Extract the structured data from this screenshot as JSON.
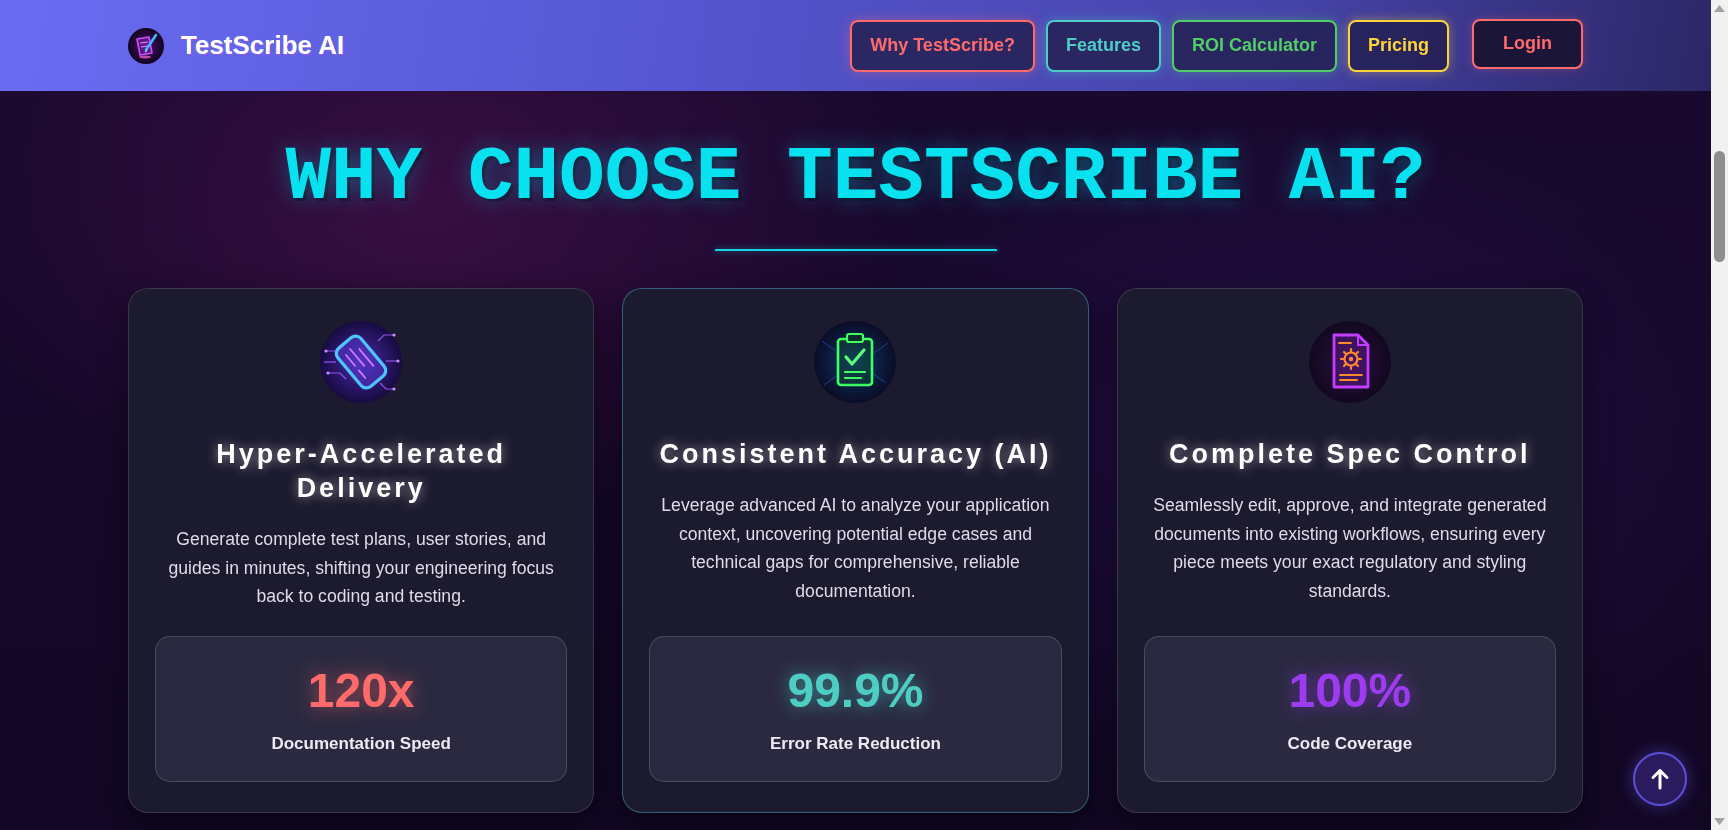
{
  "navbar": {
    "brand": "TestScribe AI",
    "links": [
      {
        "label": "Why TestScribe?",
        "kind": "link",
        "color": "#ff6b6b"
      },
      {
        "label": "Features",
        "kind": "link",
        "color": "#4ecdc4"
      },
      {
        "label": "ROI Calculator",
        "kind": "link",
        "color": "#51cf66"
      },
      {
        "label": "Pricing",
        "kind": "link",
        "color": "#ffd43b"
      },
      {
        "label": "Login",
        "kind": "button",
        "color": "#ff6b6b"
      }
    ]
  },
  "section": {
    "title": "WHY CHOOSE TESTSCRIBE AI?",
    "cards": [
      {
        "title": "Hyper-Accelerated Delivery",
        "description": "Generate complete test plans, user stories, and guides in minutes, shifting your engineering focus back to coding and testing.",
        "hovered": false,
        "stat": {
          "value": "120x",
          "label": "Documentation Speed",
          "color": "#ff6b6b"
        }
      },
      {
        "title": "Consistent Accuracy (AI)",
        "description": "Leverage advanced AI to analyze your application context, uncovering potential edge cases and technical gaps for comprehensive, reliable documentation.",
        "hovered": true,
        "stat": {
          "value": "99.9%",
          "label": "Error Rate Reduction",
          "color": "#4ecdc4"
        }
      },
      {
        "title": "Complete Spec Control",
        "description": "Seamlessly edit, approve, and integrate generated documents into existing workflows, ensuring every piece meets your exact regulatory and styling standards.",
        "hovered": false,
        "stat": {
          "value": "100%",
          "label": "Code Coverage",
          "color": "#9d3bf0"
        }
      }
    ]
  }
}
